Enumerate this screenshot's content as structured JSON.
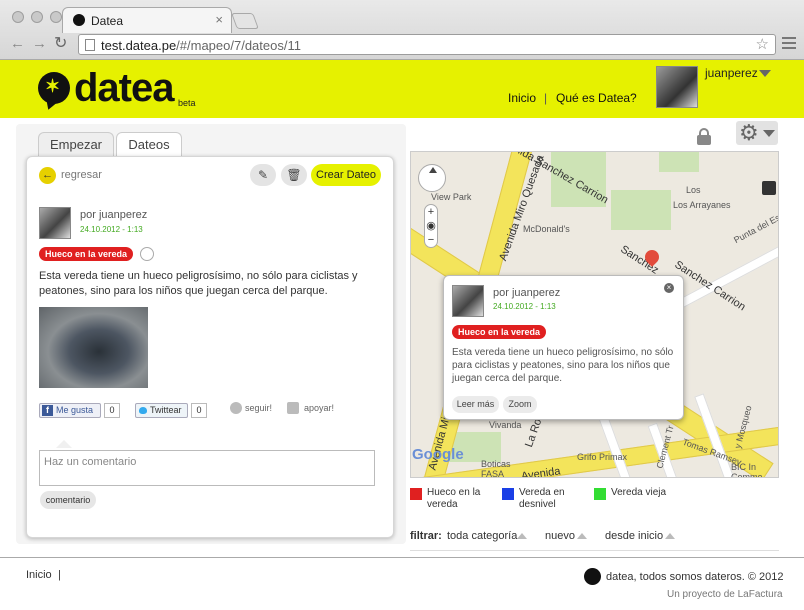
{
  "browser": {
    "tab_title": "Datea",
    "url_prefix": "test.datea.pe",
    "url_path": "/#/mapeo/7/dateos/11"
  },
  "header": {
    "logo_text": "datea",
    "logo_beta": "beta",
    "nav_home": "Inicio",
    "nav_sep": "|",
    "nav_about": "Qué es Datea?",
    "username": "juanperez",
    "accent_color": "#e6f100"
  },
  "panel": {
    "tabs": [
      "Empezar",
      "Dateos"
    ],
    "active_tab": "Dateos",
    "back_label": "regresar",
    "create_label": "Crear Dateo",
    "post": {
      "author": "por juanperez",
      "date": "24.10.2012 - 1:13",
      "category": "Hueco en la vereda",
      "description": "Esta vereda tiene un hueco peligrosísimo, no sólo para ciclistas y peatones, sino para los niños que juegan cerca del parque."
    },
    "social": {
      "like_label": "Me gusta",
      "like_count": "0",
      "tweet_label": "Twittear",
      "tweet_count": "0",
      "follow_label": "seguir!",
      "support_label": "apoyar!"
    },
    "comment_placeholder": "Haz un comentario",
    "comment_button": "comentario"
  },
  "map": {
    "labels": {
      "avenida_sanchez_top": "Avenida Sanchez Carrion",
      "avenida_sanchez_right": "Sanchez Carrion",
      "sanchez_left": "Sanchez",
      "miro_quesada_top": "Avenida Miro Quesada",
      "miro_quesada_bottom": "Avenida Miro Quesada",
      "view_park": "View Park",
      "mcdonalds": "McDonald's",
      "los_arrayanes": "Los Arrayanes",
      "punta_del_este": "Punta del Este",
      "vivanda": "Vivanda",
      "la_roca": "La Ro",
      "grifo_primax": "Grifo Primax",
      "boticas_fasa": "Boticas FASA",
      "tomas_ramsey": "Tomas Ramsey",
      "avenida_bottom": "Avenida",
      "bic": "BIC In Comme",
      "clement": "Clement Tr",
      "mosqueo": "y Mosqueo",
      "los": "Los"
    },
    "popup": {
      "author": "por juanperez",
      "date": "24.10.2012 - 1:13",
      "category": "Hueco en la vereda",
      "description": "Esta vereda tiene un hueco peligrosísimo, no sólo para ciclistas y peatones, sino para los niños que juegan cerca del parque.",
      "read_more": "Leer más",
      "zoom": "Zoom"
    },
    "google_label": "Google"
  },
  "legend": [
    {
      "label": "Hueco en la vereda",
      "color": "#e02020"
    },
    {
      "label": "Vereda en desnivel",
      "color": "#1a3fe6"
    },
    {
      "label": "Vereda vieja",
      "color": "#33dd33"
    }
  ],
  "filters": {
    "label": "filtrar:",
    "category": "toda categoría",
    "order": "nuevo",
    "since": "desde inicio"
  },
  "footer": {
    "home_link": "Inicio",
    "sep": "|",
    "copyright": "datea, todos somos dateros. © 2012",
    "credit": "Un proyecto de LaFactura"
  }
}
